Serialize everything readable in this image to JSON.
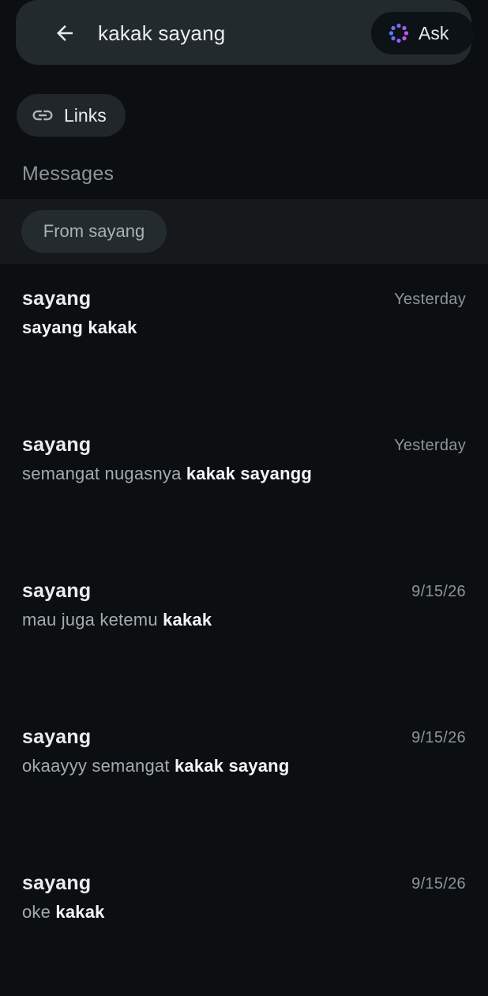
{
  "search": {
    "query": "kakak sayang",
    "ask_label": "Ask"
  },
  "filters": {
    "links_label": "Links"
  },
  "messages": {
    "section_title": "Messages",
    "from_filter_label": "From sayang",
    "results": [
      {
        "sender": "sayang",
        "time": "Yesterday",
        "plain": "",
        "highlight": "sayang kakak"
      },
      {
        "sender": "sayang",
        "time": "Yesterday",
        "plain": "semangat nugasnya ",
        "highlight": "kakak sayangg"
      },
      {
        "sender": "sayang",
        "time": "9/15/26",
        "plain": "mau juga ketemu ",
        "highlight": "kakak"
      },
      {
        "sender": "sayang",
        "time": "9/15/26",
        "plain": "okaayyy semangat ",
        "highlight": "kakak sayang"
      },
      {
        "sender": "sayang",
        "time": "9/15/26",
        "plain": "oke ",
        "highlight": "kakak"
      }
    ]
  },
  "colors": {
    "background": "#0b0f12",
    "surface": "#232a2e",
    "text_primary": "#e9edef",
    "text_secondary": "#8d9599",
    "ask_icon": "#9b5cf6"
  },
  "icons": {
    "back": "arrow-left-icon",
    "ask": "meta-ai-sparkle-icon",
    "links": "link-icon"
  }
}
